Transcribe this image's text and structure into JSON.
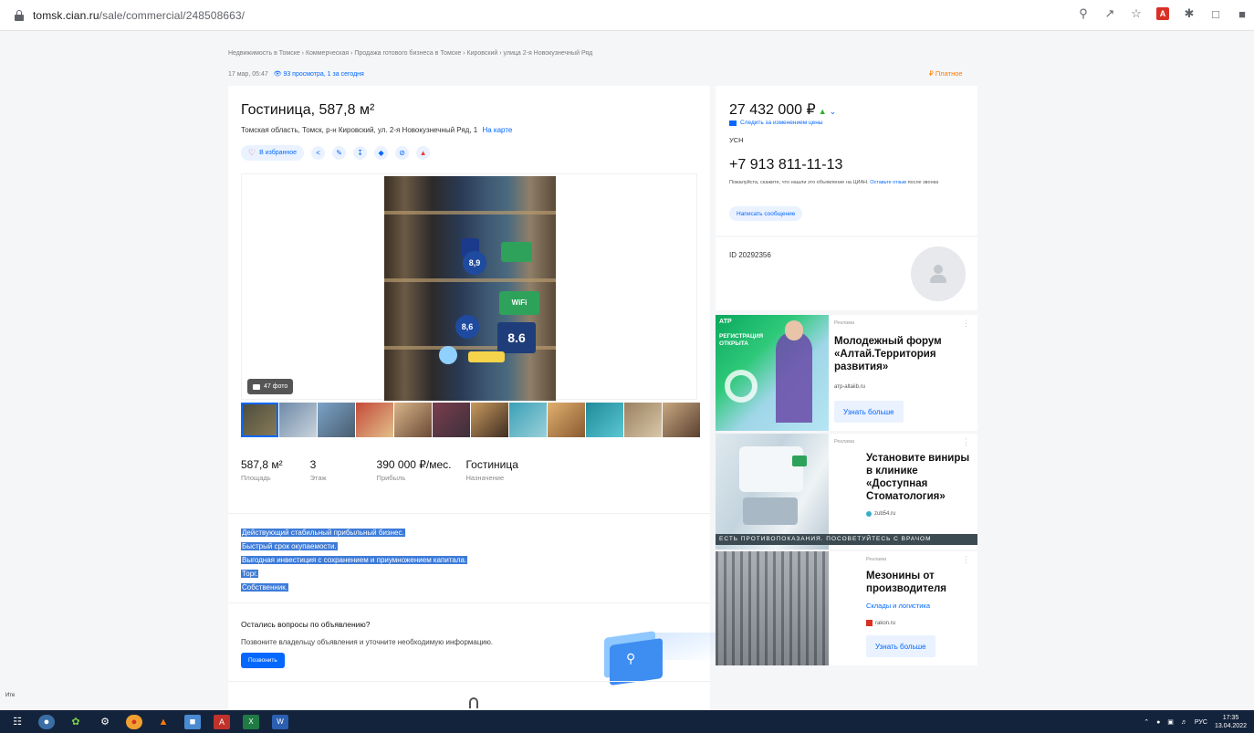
{
  "browser": {
    "url_prefix": "tomsk.cian.ru",
    "url_path": "/sale/commercial/248508663/"
  },
  "breadcrumbs": "Недвижимость в Томске  ›  Коммерческая  ›  Продажа готового бизнеса в Томске  ›  Кировский  ›  улица 2-я Новокузнечный Ряд",
  "meta": {
    "date": "17 мар, 05:47",
    "views": "93 просмотра, 1 за сегодня"
  },
  "paid_label": "Платное",
  "listing": {
    "title": "Гостиница, 587,8 м²",
    "address": "Томская область, Томск, р-н Кировский, ул. 2-я Новокузнечный Ряд, 1",
    "map_link": "На карте",
    "favorite_label": "В избранное",
    "photo_count": "47 фото",
    "facts": [
      {
        "value": "587,8 м²",
        "label": "Площадь"
      },
      {
        "value": "3",
        "label": "Этаж"
      },
      {
        "value": "390 000 ₽/мес.",
        "label": "Прибыль"
      },
      {
        "value": "Гостиница",
        "label": "Назначение"
      }
    ],
    "description": [
      "Действующий стабильный прибыльный бизнес.",
      "Быстрый срок окупаемости.",
      "Выгодная инвестиция с сохранением и приумножением капитала.",
      "Торг.",
      "Собственник."
    ],
    "photo_numbers": [
      "8,9",
      "8,6",
      "8.6"
    ],
    "photo_sign_text": "WiFi"
  },
  "questions": {
    "title": "Остались вопросы по объявлению?",
    "subtitle": "Позвоните владельцу объявления и уточните необходимую информацию.",
    "call_button": "Позвонить"
  },
  "sidebar": {
    "price": "27 432 000 ₽",
    "follow_price": "Следить за изменением цены",
    "tax": "УСН",
    "phone": "+7 913 811-11-13",
    "phone_note_before": "Пожалуйста, скажите, что нашли это объявление на ЦИАН.",
    "phone_note_link": "Оставьте отзыв",
    "phone_note_after": "после звонка",
    "message_button": "Написать сообщение",
    "id_text": "ID 20292356"
  },
  "ads": [
    {
      "label": "Реклама",
      "headline": "Молодежный форум «Алтай.Территория развития»",
      "source": "атр-altaiib.ru",
      "button": "Узнать больше",
      "image_text": "РЕГИСТРАЦИЯ ОТКРЫТА",
      "image_badge": "АТР"
    },
    {
      "label": "Реклама",
      "headline": "Установите виниры в клинике «Доступная Стоматология»",
      "source": "zub54.ru",
      "strip": "ЕСТЬ ПРОТИВОПОКАЗАНИЯ. ПОСОВЕТУЙТЕСЬ С ВРАЧОМ"
    },
    {
      "label": "Реклама",
      "headline": "Мезонины от производителя",
      "subline": "Склады и логистика",
      "source": "rakon.ru",
      "button": "Узнать больше"
    }
  ],
  "taskbar": {
    "lang": "РУС",
    "time": "17:35",
    "date": "13.04.2022"
  },
  "left_edge_text": "Ите",
  "colors": {
    "accent": "#0468ff",
    "selection": "#3d7bd9",
    "taskbar": "#14233c",
    "paid": "#ff7a00"
  }
}
